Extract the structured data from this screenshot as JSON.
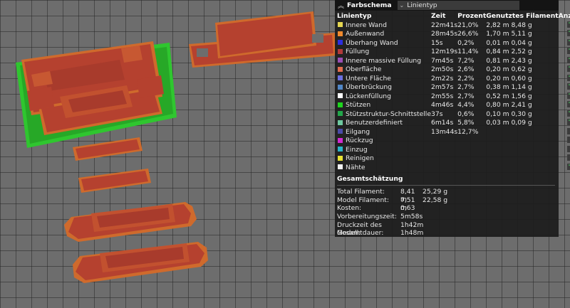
{
  "panel": {
    "title": "Farbschema",
    "dropdown_value": "Linientyp",
    "columns": [
      "Linientyp",
      "Zeit",
      "Prozent",
      "Genutztes Filament",
      "Anzeigen"
    ],
    "rows": [
      {
        "name": "Innere Wand",
        "color": "#e5d651",
        "time": "22m41s",
        "pct": "21,0%",
        "fil": "2,82 m  8,48 g",
        "show": true
      },
      {
        "name": "Außenwand",
        "color": "#ef8a2e",
        "time": "28m45s",
        "pct": "26,6%",
        "fil": "1,70 m  5,11 g",
        "show": true
      },
      {
        "name": "Überhang Wand",
        "color": "#2d2ee0",
        "time": "15s",
        "pct": "0,2%",
        "fil": "0,01 m  0,04 g",
        "show": true
      },
      {
        "name": "Füllung",
        "color": "#b1393a",
        "time": "12m19s",
        "pct": "11,4%",
        "fil": "0,84 m  2,52 g",
        "show": true
      },
      {
        "name": "Innere massive Füllung",
        "color": "#9a4fb5",
        "time": "7m45s",
        "pct": "7,2%",
        "fil": "0,81 m  2,43 g",
        "show": true
      },
      {
        "name": "Oberfläche",
        "color": "#e36d4e",
        "time": "2m50s",
        "pct": "2,6%",
        "fil": "0,20 m  0,62 g",
        "show": true
      },
      {
        "name": "Untere Fläche",
        "color": "#6a6ee0",
        "time": "2m22s",
        "pct": "2,2%",
        "fil": "0,20 m  0,60 g",
        "show": true
      },
      {
        "name": "Überbrückung",
        "color": "#5086c6",
        "time": "2m57s",
        "pct": "2,7%",
        "fil": "0,38 m  1,14 g",
        "show": true
      },
      {
        "name": "Lückenfüllung",
        "color": "#ffffff",
        "time": "2m55s",
        "pct": "2,7%",
        "fil": "0,52 m  1,56 g",
        "show": true
      },
      {
        "name": "Stützen",
        "color": "#1ed41e",
        "time": "4m46s",
        "pct": "4,4%",
        "fil": "0,80 m  2,41 g",
        "show": true
      },
      {
        "name": "Stützstruktur-Schnittstelle",
        "color": "#22a64a",
        "time": "37s",
        "pct": "0,6%",
        "fil": "0,10 m  0,30 g",
        "show": true
      },
      {
        "name": "Benutzerdefiniert",
        "color": "#6ec9a0",
        "time": "6m14s",
        "pct": "5,8%",
        "fil": "0,03 m  0,09 g",
        "show": true
      },
      {
        "name": "Eilgang",
        "color": "#4a4aa8",
        "time": "13m44s",
        "pct": "12,7%",
        "fil": "",
        "show": false
      },
      {
        "name": "Rückzug",
        "color": "#d02bd0",
        "time": "",
        "pct": "",
        "fil": "",
        "show": false
      },
      {
        "name": "Einzug",
        "color": "#2ab4c8",
        "time": "",
        "pct": "",
        "fil": "",
        "show": false
      },
      {
        "name": "Reinigen",
        "color": "#e8e233",
        "time": "",
        "pct": "",
        "fil": "",
        "show": false
      },
      {
        "name": "Nähte",
        "color": "#f2f2f2",
        "time": "",
        "pct": "",
        "fil": "",
        "show": true
      }
    ],
    "estimate": {
      "heading": "Gesamtschätzung",
      "rows": [
        {
          "k": "Total Filament:",
          "v1": "8,41 m",
          "v2": "25,29 g"
        },
        {
          "k": "Model Filament:",
          "v1": "7,51 m",
          "v2": "22,58 g"
        },
        {
          "k": "Kosten:",
          "v1": "0,63",
          "v2": ""
        },
        {
          "k": "Vorbereitungszeit:",
          "v1": "5m58s",
          "v2": ""
        },
        {
          "k": "Druckzeit des Modell:",
          "v1": "1h42m",
          "v2": ""
        },
        {
          "k": "Gesamtdauer:",
          "v1": "1h48m",
          "v2": ""
        }
      ]
    }
  },
  "colors": {
    "model": "#b5412f",
    "model_edge": "#d46a2a",
    "support": "#2fc62f",
    "panel_bg": "#1c1c1c"
  }
}
